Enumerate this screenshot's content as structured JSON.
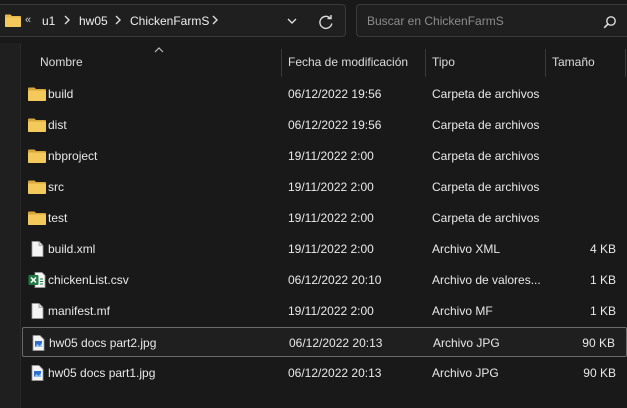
{
  "address": {
    "overflow": "«",
    "crumbs": [
      "u1",
      "hw05",
      "ChickenFarmS"
    ]
  },
  "search": {
    "placeholder": "Buscar en ChickenFarmS"
  },
  "columns": {
    "name": "Nombre",
    "date": "Fecha de modificación",
    "type": "Tipo",
    "size": "Tamaño"
  },
  "files": [
    {
      "name": "build",
      "date": "06/12/2022 19:56",
      "type": "Carpeta de archivos",
      "size": "",
      "icon": "folder-icon"
    },
    {
      "name": "dist",
      "date": "06/12/2022 19:56",
      "type": "Carpeta de archivos",
      "size": "",
      "icon": "folder-icon"
    },
    {
      "name": "nbproject",
      "date": "19/11/2022 2:00",
      "type": "Carpeta de archivos",
      "size": "",
      "icon": "folder-icon"
    },
    {
      "name": "src",
      "date": "19/11/2022 2:00",
      "type": "Carpeta de archivos",
      "size": "",
      "icon": "folder-icon"
    },
    {
      "name": "test",
      "date": "19/11/2022 2:00",
      "type": "Carpeta de archivos",
      "size": "",
      "icon": "folder-icon"
    },
    {
      "name": "build.xml",
      "date": "19/11/2022 2:00",
      "type": "Archivo XML",
      "size": "4 KB",
      "icon": "document-icon"
    },
    {
      "name": "chickenList.csv",
      "date": "06/12/2022 20:10",
      "type": "Archivo de valores...",
      "size": "1 KB",
      "icon": "excel-icon"
    },
    {
      "name": "manifest.mf",
      "date": "19/11/2022 2:00",
      "type": "Archivo MF",
      "size": "1 KB",
      "icon": "document-icon"
    },
    {
      "name": "hw05 docs part2.jpg",
      "date": "06/12/2022 20:13",
      "type": "Archivo JPG",
      "size": "90 KB",
      "icon": "image-file-icon"
    },
    {
      "name": "hw05 docs part1.jpg",
      "date": "06/12/2022 20:13",
      "type": "Archivo JPG",
      "size": "90 KB",
      "icon": "image-file-icon"
    }
  ],
  "colors": {
    "folder": "#e8b84a",
    "background": "#191919",
    "excel": "#1f7a44",
    "image_accent": "#2f6fcf"
  }
}
